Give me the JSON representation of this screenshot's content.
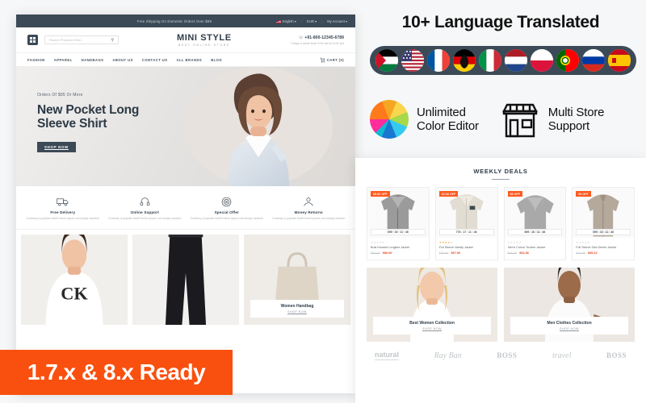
{
  "storefront": {
    "topbar": {
      "shipping_text": "Free Shipping On Domestic Orders Over $99",
      "language": "English",
      "currency": "EUR",
      "account": "My Account",
      "caret": "▾"
    },
    "header": {
      "search_placeholder": "Search Products Here..",
      "search_icon": "⚲",
      "logo_name": "MINI STYLE",
      "logo_tagline": "BEST ONLINE STORE",
      "phone": "+91-800-12345-6789",
      "phone_hours": "7 Days a week from 9:00 am to 5:00 pm"
    },
    "nav": {
      "items": [
        "FASHION",
        "APPAREL",
        "HANDBAGS",
        "ABOUT US",
        "CONTACT US",
        "ALL BRANDS",
        "BLOG"
      ],
      "cart_label": "CART (0)"
    },
    "hero": {
      "eyebrow": "Orders Of $95 Or More",
      "title_line1": "New Pocket Long",
      "title_line2": "Sleeve Shirt",
      "cta": "SHOP NOW"
    },
    "services": [
      {
        "icon": "delivery-truck-icon",
        "title": "Free Delivery",
        "desc": "Contrary a popular belief lorem ipsum not simply random"
      },
      {
        "icon": "headset-icon",
        "title": "Online Support",
        "desc": "Contrary a popular belief lorem ipsum not simply random"
      },
      {
        "icon": "tag-offer-icon",
        "title": "Special Offer",
        "desc": "Contrary a popular belief lorem ipsum not simply random"
      },
      {
        "icon": "money-return-icon",
        "title": "Money Returns",
        "desc": "Contrary a popular belief lorem ipsum not simply random"
      }
    ],
    "bottom_cards": [
      {
        "title": "",
        "cta": ""
      },
      {
        "title": "",
        "cta": ""
      },
      {
        "title": "Women Handbag",
        "cta": "SHOP NOW"
      }
    ]
  },
  "features": {
    "headline": "10+ Language Translated",
    "flags": [
      {
        "name": "flag-palestine-icon",
        "label": "Arabic"
      },
      {
        "name": "flag-usa-icon",
        "label": "English"
      },
      {
        "name": "flag-france-icon",
        "label": "French"
      },
      {
        "name": "flag-germany-icon",
        "label": "German"
      },
      {
        "name": "flag-italy-icon",
        "label": "Italian"
      },
      {
        "name": "flag-netherlands-icon",
        "label": "Dutch"
      },
      {
        "name": "flag-poland-icon",
        "label": "Polish"
      },
      {
        "name": "flag-portugal-icon",
        "label": "Portuguese"
      },
      {
        "name": "flag-russia-icon",
        "label": "Russian"
      },
      {
        "name": "flag-spain-icon",
        "label": "Spanish"
      }
    ],
    "color_editor_line1": "Unlimited",
    "color_editor_line2": "Color Editor",
    "multi_store_line1": "Multi Store",
    "multi_store_line2": "Support"
  },
  "deals": {
    "heading": "WEEKLY DEALS",
    "products": [
      {
        "badge": "€5.00 OFF",
        "timer": "699 : 16 : 11 : 46",
        "stars": 0,
        "name": "Bust Hooded Longline Jacket",
        "old_price": "€84.00",
        "new_price": "€80.00"
      },
      {
        "badge": "€3.00 OFF",
        "timer": "778 : 17 : 11 : 46",
        "stars": 4,
        "name": "Full Sleeve Varsity Jacket",
        "old_price": "€70.00",
        "new_price": "€67.00"
      },
      {
        "badge": "€5 OFF",
        "timer": "699 : 16 : 11 : 46",
        "stars": 0,
        "name": "Men's Colour Trucker Jacket",
        "old_price": "€66.00",
        "new_price": "€63.36"
      },
      {
        "badge": "€5 OFF",
        "timer": "699 : 16 : 11 : 46",
        "stars": 0,
        "name": "Full Sleeve Slim Denim Jacket",
        "old_price": "€72.00",
        "new_price": "€69.22"
      }
    ],
    "banners": [
      {
        "title": "Best Women Collection",
        "cta": "SHOP NOW"
      },
      {
        "title": "Men Clothes Collection",
        "cta": "SHOP NOW"
      }
    ],
    "brands": [
      "natural",
      "Ray Ban",
      "BOSS",
      "travel",
      "BOSS"
    ]
  },
  "ribbon": {
    "text": "1.7.x & 8.x Ready",
    "color": "#f9500f"
  }
}
